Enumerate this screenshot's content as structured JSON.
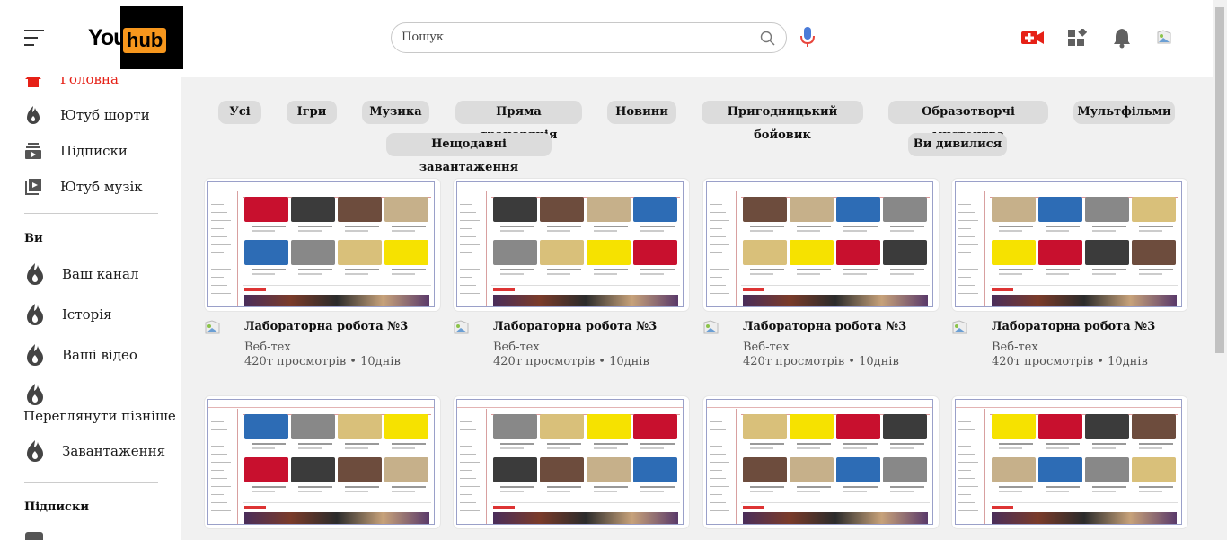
{
  "header": {
    "logo_part1": "You",
    "logo_part2": "hub",
    "search_placeholder": "Пошук",
    "icons": [
      "menu-icon",
      "search-icon",
      "mic-icon",
      "create-video-icon",
      "apps-icon",
      "bell-icon",
      "avatar"
    ]
  },
  "sidebar": {
    "main": [
      {
        "label": "Головна",
        "icon": "home-icon"
      },
      {
        "label": "Ютуб шорти",
        "icon": "shorts-icon"
      },
      {
        "label": "Підписки",
        "icon": "subscriptions-icon"
      },
      {
        "label": "Ютуб музік",
        "icon": "music-icon"
      }
    ],
    "you_heading": "Ви",
    "you": [
      {
        "label": "Ваш канал",
        "icon": "flame-icon"
      },
      {
        "label": "Історія",
        "icon": "flame-icon"
      },
      {
        "label": "Ваші відео",
        "icon": "flame-icon"
      },
      {
        "label": "Переглянути пізніше",
        "icon": "flame-icon"
      },
      {
        "label": "Завантаження",
        "icon": "flame-icon"
      }
    ],
    "subs_heading": "Підписки"
  },
  "chips": [
    "Усі",
    "Ігри",
    "Музика",
    "Пряма трансляція",
    "Новини",
    "Пригодницький бойовик",
    "Образотворчі мистецтва",
    "Мультфільми",
    "Нещодавні завантаження",
    "Ви дивилися"
  ],
  "videos": [
    {
      "title": "Лабораторна робота №3",
      "channel": "Веб-тех",
      "meta": "420т просмотрів • 10днів"
    },
    {
      "title": "Лабораторна робота №3",
      "channel": "Веб-тех",
      "meta": "420т просмотрів • 10днів"
    },
    {
      "title": "Лабораторна робота №3",
      "channel": "Веб-тех",
      "meta": "420т просмотрів • 10днів"
    },
    {
      "title": "Лабораторна робота №3",
      "channel": "Веб-тех",
      "meta": "420т просмотрів • 10днів"
    },
    {
      "title": "",
      "channel": "",
      "meta": ""
    },
    {
      "title": "",
      "channel": "",
      "meta": ""
    },
    {
      "title": "",
      "channel": "",
      "meta": ""
    },
    {
      "title": "",
      "channel": "",
      "meta": ""
    }
  ],
  "colors": {
    "accent": "#e62117",
    "hub_orange": "#f7971d",
    "chip_bg": "#dcdcdc"
  }
}
